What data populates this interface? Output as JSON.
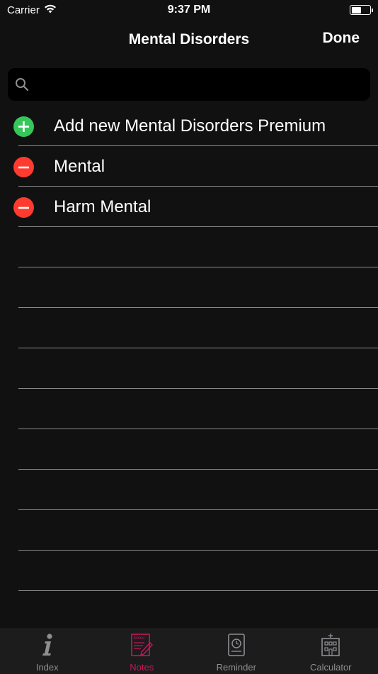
{
  "status_bar": {
    "carrier": "Carrier",
    "time": "9:37 PM",
    "battery_level": 0.55
  },
  "nav": {
    "title": "Mental Disorders",
    "done_label": "Done"
  },
  "search": {
    "placeholder": "",
    "icon": "search-icon"
  },
  "list": {
    "items": [
      {
        "label": "Add new Mental Disorders Premium",
        "action": "add"
      },
      {
        "label": "Mental",
        "action": "delete"
      },
      {
        "label": "Harm Mental",
        "action": "delete"
      }
    ],
    "empty_rows": 10
  },
  "tab_bar": {
    "tabs": [
      {
        "label": "Index",
        "icon": "info-icon",
        "active": false
      },
      {
        "label": "Notes",
        "icon": "notes-icon",
        "active": true
      },
      {
        "label": "Reminder",
        "icon": "reminder-icon",
        "active": false
      },
      {
        "label": "Calculator",
        "icon": "calculator-icon",
        "active": false
      }
    ]
  },
  "colors": {
    "background": "#111111",
    "accent": "#c2185b",
    "add_green": "#35c759",
    "delete_red": "#ff3b30"
  }
}
